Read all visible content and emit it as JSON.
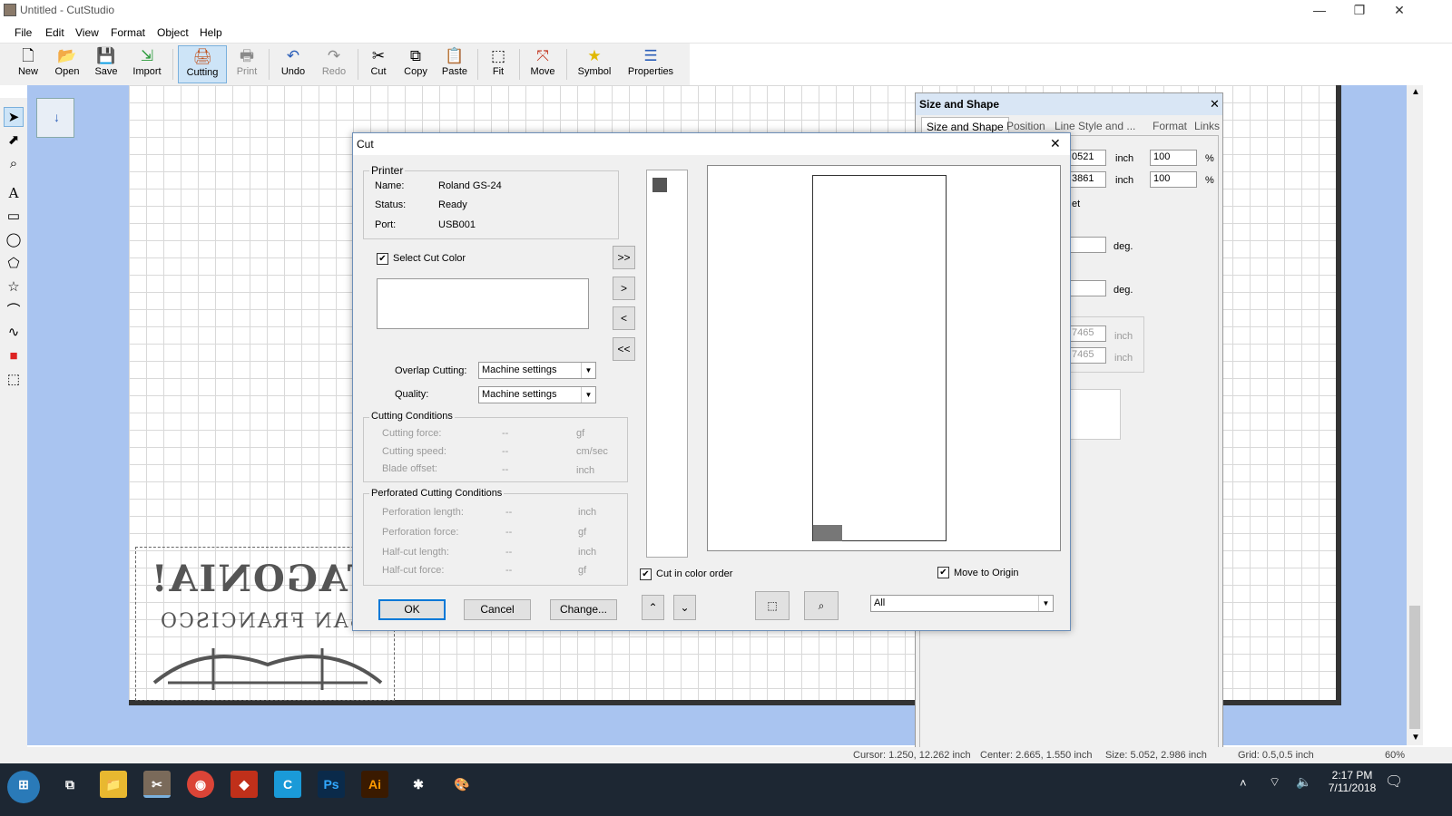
{
  "window": {
    "title": "Untitled - CutStudio",
    "minimize": "—",
    "restore": "❐",
    "close": "✕"
  },
  "menu": [
    "File",
    "Edit",
    "View",
    "Format",
    "Object",
    "Help"
  ],
  "toolbar": {
    "new": "New",
    "open": "Open",
    "save": "Save",
    "import": "Import",
    "cutting": "Cutting",
    "print": "Print",
    "undo": "Undo",
    "redo": "Redo",
    "cut": "Cut",
    "copy": "Copy",
    "paste": "Paste",
    "fit": "Fit",
    "move": "Move",
    "symbol": "Symbol",
    "properties": "Properties"
  },
  "logo": {
    "line1": "PATAGONIA!",
    "line2": "SAN FRANCISCO"
  },
  "panel": {
    "title": "Size and Shape",
    "close": "✕",
    "tabs": [
      "Size and Shape",
      "Position",
      "Line Style and ...",
      "Format",
      "Links"
    ],
    "w_value": "0521",
    "h_value": "3861",
    "w_pct": "100",
    "h_pct": "100",
    "unit": "inch",
    "pct": "%",
    "deg": "deg.",
    "et_text": "et",
    "x_value": "7465",
    "y_value": "7465"
  },
  "dialog": {
    "title": "Cut",
    "close": "✕",
    "printer": {
      "group": "Printer",
      "name_label": "Name:",
      "name": "Roland GS-24",
      "status_label": "Status:",
      "status": "Ready",
      "port_label": "Port:",
      "port": "USB001"
    },
    "select_cut_color": "Select Cut Color",
    "move_buttons": [
      ">>",
      ">",
      "<",
      "<<"
    ],
    "overlap_label": "Overlap Cutting:",
    "overlap_value": "Machine settings",
    "quality_label": "Quality:",
    "quality_value": "Machine settings",
    "cutting_conditions": {
      "group": "Cutting Conditions",
      "force": "Cutting force:",
      "speed": "Cutting speed:",
      "offset": "Blade offset:",
      "dash": "--",
      "gf": "gf",
      "cmsec": "cm/sec",
      "inch": "inch"
    },
    "perforated": {
      "group": "Perforated Cutting Conditions",
      "perf_len": "Perforation length:",
      "perf_force": "Perforation  force:",
      "half_len": "Half-cut length:",
      "half_force": "Half-cut force:",
      "dash": "--",
      "inch": "inch",
      "gf": "gf"
    },
    "cut_in_color_order": "Cut in color order",
    "move_to_origin": "Move to Origin",
    "ok": "OK",
    "cancel": "Cancel",
    "change": "Change...",
    "filter_value": "All"
  },
  "status": {
    "cursor": "Cursor: 1.250, 12.262 inch",
    "center": "Center: 2.665, 1.550 inch",
    "size": "Size: 5.052, 2.986 inch",
    "grid": "Grid: 0.5,0.5 inch",
    "zoom": "60%"
  },
  "taskbar": {
    "time": "2:17 PM",
    "date": "7/11/2018"
  }
}
